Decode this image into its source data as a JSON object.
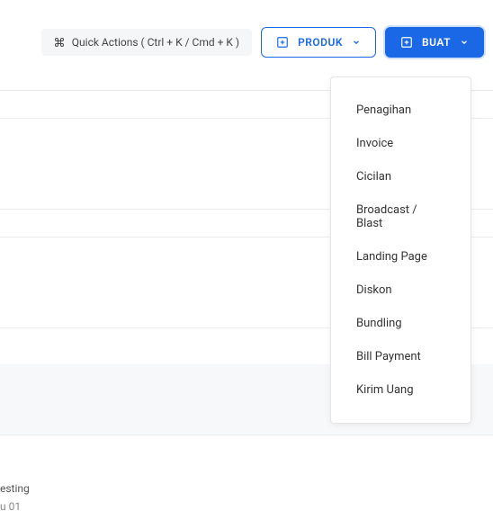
{
  "topbar": {
    "quick_actions_label": "Quick Actions ( Ctrl + K / Cmd + K )",
    "produk_label": "PRODUK",
    "buat_label": "BUAT"
  },
  "dropdown": {
    "items": [
      "Penagihan",
      "Invoice",
      "Cicilan",
      "Broadcast / Blast",
      "Landing Page",
      "Diskon",
      "Bundling",
      "Bill Payment",
      "Kirim Uang"
    ]
  },
  "footer": {
    "line1": "esting",
    "line2": "u 01"
  }
}
